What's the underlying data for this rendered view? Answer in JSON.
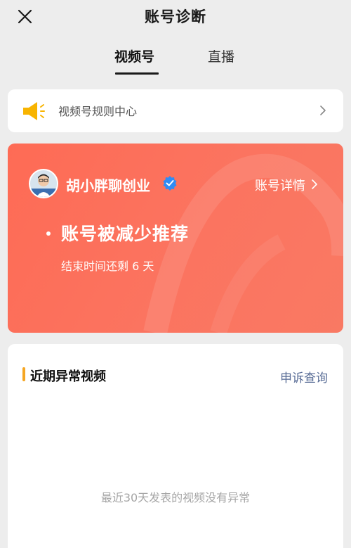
{
  "header": {
    "title": "账号诊断",
    "close_icon": "close-icon"
  },
  "tabs": [
    {
      "label": "视频号",
      "active": true
    },
    {
      "label": "直播",
      "active": false
    }
  ],
  "rules_center": {
    "label": "视频号规则中心",
    "icon": "speaker-icon",
    "accent_color": "#f8b400"
  },
  "status": {
    "account_name": "胡小胖聊创业",
    "verified": true,
    "detail_label": "账号详情",
    "title": "账号被减少推荐",
    "subtitle": "结束时间还剩 6 天",
    "card_color": "#fc6e58",
    "verify_color": "#2f8cf6"
  },
  "abnormal_videos": {
    "title": "近期异常视频",
    "appeal_label": "申诉查询",
    "empty_message": "最近30天发表的视频没有异常",
    "accent_color": "#f5a623",
    "link_color": "#576b95"
  }
}
